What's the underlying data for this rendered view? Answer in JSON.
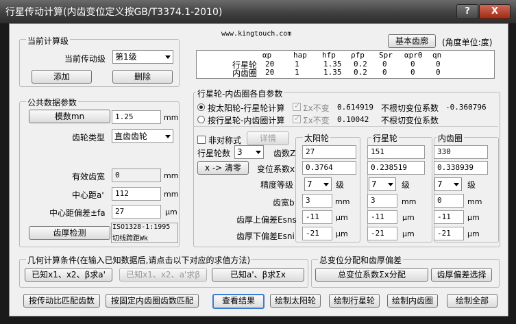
{
  "window": {
    "title": "行星传动计算(内齿变位定义按GB/T3374.1-2010)",
    "help_label": "?",
    "close_label": "X"
  },
  "header": {
    "website": "www.kingtouch.com",
    "basic_profile_button": "基本齿廓",
    "angle_unit": "(角度单位:度)"
  },
  "current_stage": {
    "group_title": "当前计算级",
    "label": "当前传动级",
    "selected": "第1级",
    "add_button": "添加",
    "delete_button": "删除"
  },
  "profile_table": {
    "headers": [
      "αp",
      "hap",
      "hfp",
      "ρfp",
      "Spr",
      "αpr0",
      "qn"
    ],
    "rows": [
      {
        "name": "行星轮",
        "values": [
          "20",
          "1",
          "1.35",
          "0.2",
          "0",
          "0",
          "0"
        ]
      },
      {
        "name": "内齿圈",
        "values": [
          "20",
          "1",
          "1.35",
          "0.2",
          "0",
          "0",
          "0"
        ]
      }
    ]
  },
  "common_params": {
    "group_title": "公共数据参数",
    "module_button": "模数mn",
    "module_value": "1.25",
    "module_unit": "mm",
    "gear_type_label": "齿轮类型",
    "gear_type_selected": "直齿齿轮",
    "face_width_label": "有效齿宽",
    "face_width_value": "0",
    "face_width_unit": "mm",
    "center_distance_label": "中心距a'",
    "center_distance_value": "112",
    "center_distance_unit": "mm",
    "center_tol_label": "中心距偏差±fa",
    "center_tol_value": "27",
    "center_tol_unit": "μm",
    "tooth_check_button": "齿厚检测",
    "standard_line1": "ISO1328-1:1995",
    "standard_line2": "切线跨距Wk"
  },
  "mesh_params": {
    "group_title": "行星轮-内齿圈各自参数",
    "radio1_label": "按太阳轮-行星轮计算",
    "radio1_chk_label": "Σx不变",
    "radio1_value": "0.614919",
    "radio1_undercut_label": "不根切变位系数",
    "radio1_undercut_value": "-0.360796",
    "radio2_label": "按行星轮-内齿圈计算",
    "radio2_chk_label": "Σx不变",
    "radio2_value": "0.10042",
    "radio2_undercut_label": "不根切变位系数",
    "asym_label": "非对称式",
    "detail_button": "详情",
    "col_sun": "太阳轮",
    "col_planet": "行星轮",
    "col_ring": "内齿圈",
    "planet_count_label": "行星轮数",
    "planet_count_value": "3",
    "teeth_label": "齿数Z",
    "clear_button": "x -> 清零",
    "shift_label": "变位系数x",
    "accuracy_label": "精度等级",
    "accuracy_unit": "级",
    "tooth_width_label": "齿宽b",
    "upper_dev_label": "齿厚上偏差Esns",
    "lower_dev_label": "齿厚下偏差Esni",
    "unit_mm": "mm",
    "unit_um": "μm",
    "sun": {
      "teeth": "27",
      "shift": "0.3764",
      "accuracy": "7",
      "width": "3",
      "upper": "-11",
      "lower": "-21"
    },
    "planet": {
      "teeth": "151",
      "shift": "0.238519",
      "accuracy": "7",
      "width": "3",
      "upper": "-11",
      "lower": "-21"
    },
    "ring": {
      "teeth": "330",
      "shift": "0.338939",
      "accuracy": "7",
      "width": "0",
      "upper": "-11",
      "lower": "-21"
    }
  },
  "geometry": {
    "group_title": "几何计算条件(在输入已知数据后,请点击以下对应的求值方法)",
    "btn1": "已知x1、x2、β求a'",
    "btn2": "已知x1、x2、a'求β",
    "btn3": "已知a'、β求Σx"
  },
  "shift_distribution": {
    "group_title": "总变位分配和齿厚偏差",
    "btn1": "总变位系数Σx分配",
    "btn2": "齿厚偏差选择"
  },
  "bottom_bar": {
    "btn1": "按传动比匹配齿数",
    "btn2": "按固定内齿圈齿数匹配",
    "btn3": "查看结果",
    "btn4": "绘制太阳轮",
    "btn5": "绘制行星轮",
    "btn6": "绘制内齿圈",
    "btn7": "绘制全部"
  }
}
